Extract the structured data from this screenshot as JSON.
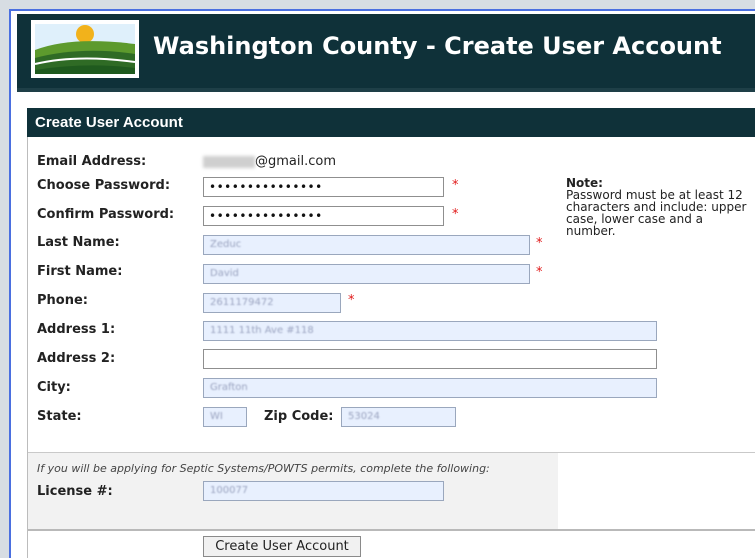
{
  "header": {
    "title": "Washington County - Create User Account"
  },
  "section": {
    "title": "Create User Account"
  },
  "form": {
    "email_label": "Email Address:",
    "email_value": "@gmail.com",
    "password_label": "Choose Password:",
    "password_value": "•••••••••••••••",
    "confirm_label": "Confirm Password:",
    "confirm_value": "•••••••••••••••",
    "last_name_label": "Last Name:",
    "last_name_value": "Zeduc",
    "first_name_label": "First Name:",
    "first_name_value": "David",
    "phone_label": "Phone:",
    "phone_value": "2611179472",
    "address1_label": "Address 1:",
    "address1_value": "1111 11th Ave #118",
    "address2_label": "Address 2:",
    "address2_value": "",
    "city_label": "City:",
    "city_value": "Grafton",
    "state_label": "State:",
    "state_value": "WI",
    "zip_label": "Zip Code:",
    "zip_value": "53024",
    "required_mark": "*"
  },
  "note": {
    "title": "Note:",
    "text": "Password must be at least 12 characters and include: upper case, lower case and a number."
  },
  "septic": {
    "note": "If you will be applying for Septic Systems/POWTS permits, complete the following:",
    "license_label": "License #:",
    "license_value": "100077"
  },
  "submit_label": "Create User Account",
  "colors": {
    "header_bg": "#0f3139",
    "autofill_bg": "#e8f0fe",
    "required": "#e01818",
    "frame_blue": "#4a6fe0"
  }
}
